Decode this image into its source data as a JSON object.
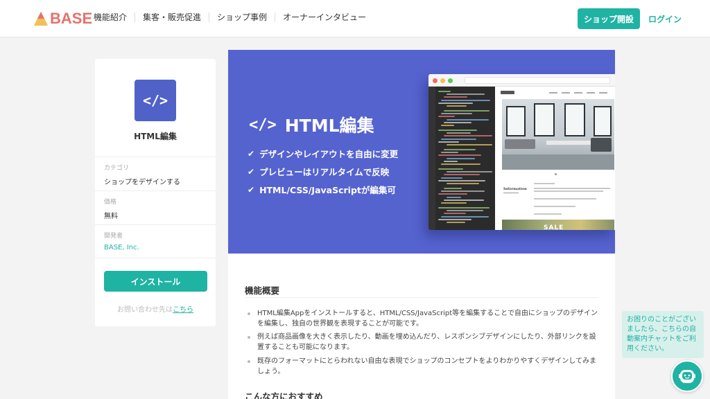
{
  "header": {
    "logo_text": "BASE",
    "nav": [
      "機能紹介",
      "集客・販売促進",
      "ショップ事例",
      "オーナーインタビュー"
    ],
    "shop_open_label": "ショップ開設",
    "login_label": "ログイン"
  },
  "app": {
    "icon": "code-icon",
    "icon_glyph": "</>",
    "name": "HTML編集",
    "category_label": "カテゴリ",
    "category_value": "ショップをデザインする",
    "price_label": "価格",
    "price_value": "無料",
    "developer_label": "開発者",
    "developer_value": "BASE, Inc.",
    "install_label": "インストール",
    "contact_prefix": "お問い合わせ先は",
    "contact_link": "こちら"
  },
  "banner": {
    "code_glyph": "</>",
    "title": "HTML編集",
    "features": [
      "デザインやレイアウトを自由に変更",
      "プレビューはリアルタイムで反映",
      "HTML/CSS/JavaScriptが編集可"
    ],
    "mock_site_heading": "Information",
    "mock_sale_text": "SALE",
    "colors": {
      "banner_bg": "#5563cf",
      "accent": "#1fb3a4"
    }
  },
  "overview": {
    "title": "機能概要",
    "bullets": [
      "HTML編集Appをインストールすると、HTML/CSS/JavaScript等を編集することで自由にショップのデザインを編集し、独自の世界観を表現することが可能です。",
      "例えば商品画像を大きく表示したり、動画を埋め込んだり、レスポンシブデザインにしたり、外部リンクを設置することも可能になります。",
      "既存のフォーマットにとらわれない自由な表現でショップのコンセプトをよりわかりやすくデザインしてみましょう。"
    ],
    "recommend_title": "こんな方におすすめ"
  },
  "chat": {
    "message": "お困りのことがございましたら、こちらの自動案内チャットをご利用ください。",
    "icon": "chat-bot-icon"
  }
}
